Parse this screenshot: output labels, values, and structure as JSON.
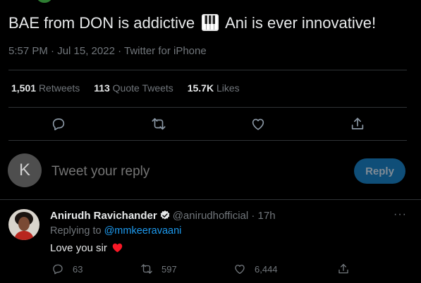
{
  "tweet": {
    "text_before": "BAE from DON is addictive",
    "emoji": "piano-keys",
    "text_after": "Ani is ever innovative!",
    "meta": "5:57 PM · Jul 15, 2022 · Twitter for iPhone"
  },
  "stats": {
    "retweets_count": "1,501",
    "retweets_label": "Retweets",
    "quotes_count": "113",
    "quotes_label": "Quote Tweets",
    "likes_count": "15.7K",
    "likes_label": "Likes"
  },
  "actions": {
    "icons": [
      "reply-icon",
      "retweet-icon",
      "like-icon",
      "share-icon"
    ]
  },
  "compose": {
    "avatar_letter": "K",
    "placeholder": "Tweet your reply",
    "button_label": "Reply"
  },
  "reply": {
    "name": "Anirudh Ravichander",
    "handle_time": "@anirudhofficial · 17h",
    "more": "···",
    "replying_prefix": "Replying to",
    "replying_mention": "@mmkeeravaani",
    "text": "Love you sir",
    "reply_count": "63",
    "retweet_count": "597",
    "like_count": "6,444"
  },
  "colors": {
    "background": "#000000",
    "accent": "#1d9bf0",
    "muted": "#71767b",
    "heart": "#f91880"
  }
}
